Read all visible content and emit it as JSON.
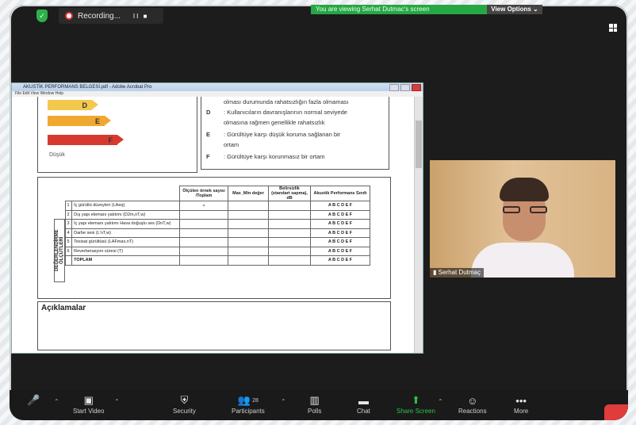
{
  "topbar": {
    "recording_label": "Recording...",
    "recording_controls": "II ■",
    "share_banner": "You are viewing Serhat Dutmac's screen",
    "view_options": "View Options"
  },
  "pdf": {
    "window_title": "AKUSTİK PERFORMANS BELGESİ.pdf - Adobe Acrobat Pro",
    "menu": "File  Edit  View  Window  Help",
    "energy_labels": [
      "D",
      "E",
      "F"
    ],
    "energy_colors": [
      "#f2c94c",
      "#f0a830",
      "#d63a2f"
    ],
    "low_label": "Düşük",
    "legend": [
      {
        "k": "",
        "t": "olması durumunda rahatsızlığın fazla olmaması"
      },
      {
        "k": "D",
        "t": ": Kullanıcıların davranışlarının normal seviyede"
      },
      {
        "k": "",
        "t": "olmasına rağmen genellikle rahatsızlık"
      },
      {
        "k": "E",
        "t": ": Gürültüye karşı düşük koruma sağlanan bir"
      },
      {
        "k": "",
        "t": "ortam"
      },
      {
        "k": "F",
        "t": ": Gürültüye karşı korunmasız bir ortam"
      }
    ],
    "table": {
      "headers": [
        "Ölçülen örnek sayısı /Toplam",
        "Max_Min değer",
        "Belirsizlik (standart sapma), dB",
        "Akustik Performans Sınıfı"
      ],
      "row_group_label": "DEĞERLENDİRME ÖLÇÜTLERİ",
      "rows": [
        {
          "n": "1",
          "name": "İç gürültü düzeyleri (LAeq)",
          "extra": "",
          "grades": "A B C D E F"
        },
        {
          "n": "2",
          "name": "Dış yapı elemanı yalıtımı (D2m,nT,w)",
          "extra": "",
          "grades": "A B C D E F"
        },
        {
          "n": "3",
          "name": "İç yapı elemanı yalıtımı",
          "extra": "Hava doğuşlu ses (DnT,w)",
          "grades": "A B C D E F"
        },
        {
          "n": "4",
          "name": "",
          "extra": "Darbe sesi (L'nT,w)",
          "grades": "A B C D E F"
        },
        {
          "n": "5",
          "name": "Tesisat gürültüsü (LAFmax,nT)",
          "extra": "",
          "grades": "A B C D E F"
        },
        {
          "n": "6",
          "name": "Reverberasyon süresi (T)",
          "extra": "",
          "grades": "A B C D E F"
        },
        {
          "n": "",
          "name": "TOPLAM",
          "extra": "",
          "grades": "A B C D E F"
        }
      ]
    },
    "aciklamalar": "Açıklamalar"
  },
  "video": {
    "participant_name": "Serhat Dutmaç"
  },
  "toolbar": {
    "items": [
      {
        "label": "Start Video",
        "icon": "video-off-icon"
      },
      {
        "label": "Security",
        "icon": "shield-icon"
      },
      {
        "label": "Participants",
        "icon": "participants-icon",
        "count": "28"
      },
      {
        "label": "Polls",
        "icon": "polls-icon"
      },
      {
        "label": "Chat",
        "icon": "chat-icon"
      },
      {
        "label": "Share Screen",
        "icon": "share-screen-icon"
      },
      {
        "label": "Reactions",
        "icon": "reactions-icon"
      },
      {
        "label": "More",
        "icon": "more-icon"
      }
    ]
  }
}
